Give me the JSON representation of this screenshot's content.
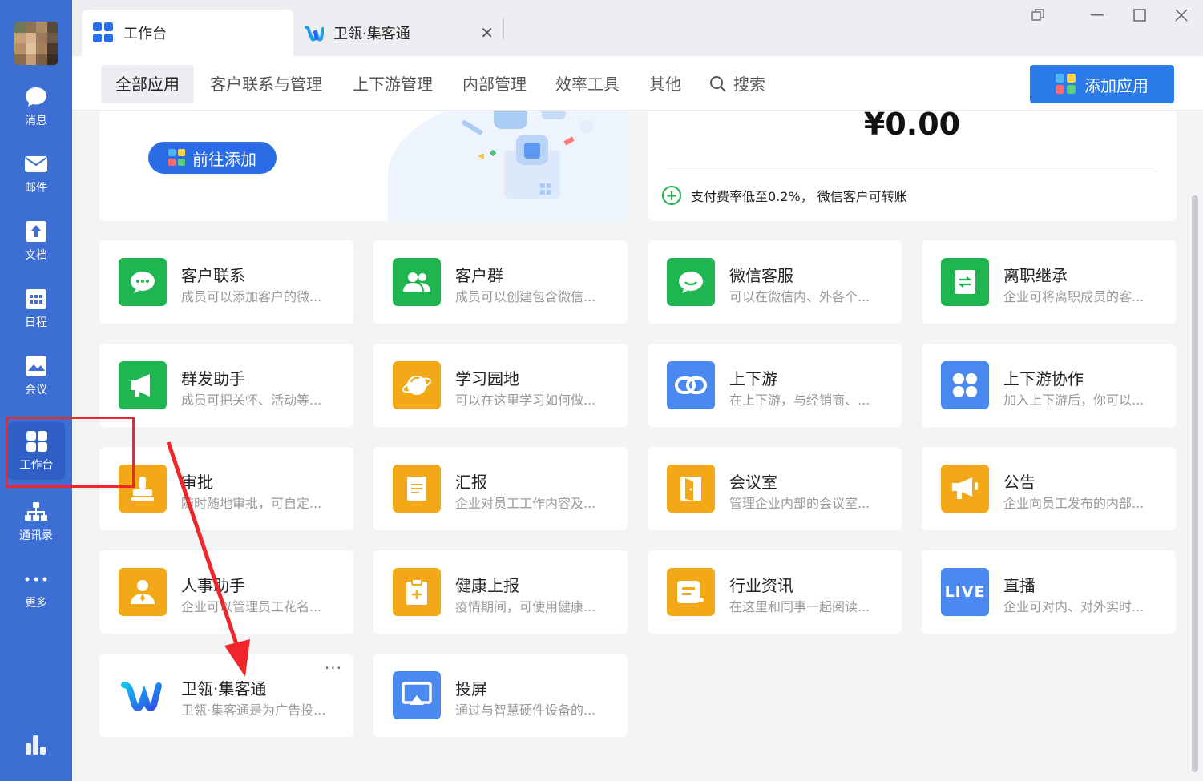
{
  "sidebar": {
    "items": [
      {
        "label": "消息",
        "icon": "chat-bubble-icon"
      },
      {
        "label": "邮件",
        "icon": "mail-icon"
      },
      {
        "label": "文档",
        "icon": "document-icon"
      },
      {
        "label": "日程",
        "icon": "calendar-icon"
      },
      {
        "label": "会议",
        "icon": "meeting-icon"
      },
      {
        "label": "工作台",
        "icon": "workbench-grid-icon"
      },
      {
        "label": "通讯录",
        "icon": "org-chart-icon"
      },
      {
        "label": "更多",
        "icon": "more-dots-icon"
      }
    ],
    "active": "工作台"
  },
  "tabs": [
    {
      "label": "工作台",
      "icon": "workbench-grid-icon"
    },
    {
      "label": "卫瓴·集客通",
      "icon": "weiling-logo-icon"
    }
  ],
  "categories": [
    "全部应用",
    "客户联系与管理",
    "上下游管理",
    "内部管理",
    "效率工具",
    "其他"
  ],
  "search_label": "搜索",
  "add_app_label": "添加应用",
  "banner": {
    "goto_label": "前往添加",
    "amount": "¥0.00",
    "pay_note": "支付费率低至0.2%， 微信客户可转账"
  },
  "apps": [
    {
      "name": "客户联系",
      "desc": "成员可以添加客户的微...",
      "icon": "chat-icon",
      "color": "#1fb651"
    },
    {
      "name": "客户群",
      "desc": "成员可以创建包含微信...",
      "icon": "group-icon",
      "color": "#1fb651"
    },
    {
      "name": "微信客服",
      "desc": "可以在微信内、外各个...",
      "icon": "service-chat-icon",
      "color": "#1fb651"
    },
    {
      "name": "离职继承",
      "desc": "企业可将离职成员的客...",
      "icon": "transfer-icon",
      "color": "#1fb651"
    },
    {
      "name": "群发助手",
      "desc": "成员可把关怀、活动等...",
      "icon": "megaphone-icon",
      "color": "#1fb651"
    },
    {
      "name": "学习园地",
      "desc": "可以在这里学习如何做...",
      "icon": "planet-icon",
      "color": "#f3a917"
    },
    {
      "name": "上下游",
      "desc": "在上下游，与经销商、...",
      "icon": "link-icon",
      "color": "#4a8af0"
    },
    {
      "name": "上下游协作",
      "desc": "加入上下游后，你可以...",
      "icon": "grid-dots-icon",
      "color": "#4a8af0"
    },
    {
      "name": "审批",
      "desc": "随时随地审批，可自定...",
      "icon": "stamp-icon",
      "color": "#f3a917"
    },
    {
      "name": "汇报",
      "desc": "企业对员工工作内容及...",
      "icon": "report-icon",
      "color": "#f3a917"
    },
    {
      "name": "会议室",
      "desc": "管理企业内部的会议室...",
      "icon": "door-icon",
      "color": "#f3a917"
    },
    {
      "name": "公告",
      "desc": "企业向员工发布的内部...",
      "icon": "announce-icon",
      "color": "#f3a917"
    },
    {
      "name": "人事助手",
      "desc": "企业可以管理员工花名...",
      "icon": "person-icon",
      "color": "#f3a917"
    },
    {
      "name": "健康上报",
      "desc": "疫情期间，可使用健康...",
      "icon": "clipboard-plus-icon",
      "color": "#f3a917"
    },
    {
      "name": "行业资讯",
      "desc": "在这里和同事一起阅读...",
      "icon": "news-icon",
      "color": "#f3a917"
    },
    {
      "name": "直播",
      "desc": "企业可对内、对外实时...",
      "icon": "live-icon",
      "color": "#4a8af0",
      "icon_text": "LIVE"
    },
    {
      "name": "卫瓴·集客通",
      "desc": "卫瓴·集客通是为广告投...",
      "icon": "weiling-logo-icon",
      "color": "#ffffff"
    },
    {
      "name": "投屏",
      "desc": "通过与智慧硬件设备的...",
      "icon": "cast-screen-icon",
      "color": "#4a8af0"
    }
  ]
}
